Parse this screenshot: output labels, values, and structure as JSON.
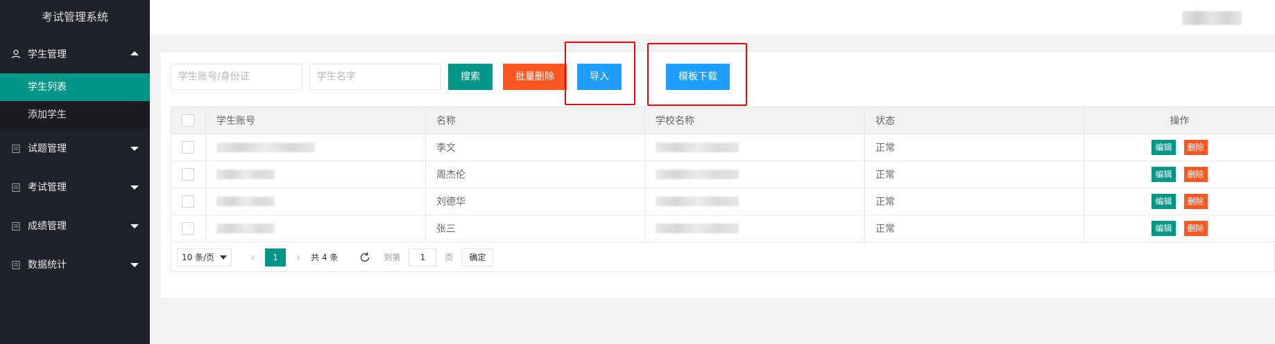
{
  "app": {
    "title": "考试管理系统"
  },
  "sidebar": {
    "groups": [
      {
        "label": "学生管理",
        "icon": "user-icon",
        "expanded": true,
        "items": [
          {
            "label": "学生列表",
            "active": true
          },
          {
            "label": "添加学生",
            "active": false
          }
        ]
      },
      {
        "label": "试题管理",
        "icon": "clipboard-icon",
        "expanded": false
      },
      {
        "label": "考试管理",
        "icon": "clipboard-icon",
        "expanded": false
      },
      {
        "label": "成绩管理",
        "icon": "clipboard-icon",
        "expanded": false
      },
      {
        "label": "数据统计",
        "icon": "clipboard-icon",
        "expanded": false
      }
    ]
  },
  "toolbar": {
    "account_placeholder": "学生账号/身份证",
    "name_placeholder": "学生名字",
    "search_label": "搜索",
    "batch_delete_label": "批量删除",
    "import_label": "导入",
    "template_download_label": "模板下载"
  },
  "table": {
    "columns": [
      "学生账号",
      "名称",
      "学校名称",
      "状态",
      "操作"
    ],
    "rows": [
      {
        "name": "李文",
        "status": "正常"
      },
      {
        "name": "周杰伦",
        "status": "正常"
      },
      {
        "name": "刘德华",
        "status": "正常"
      },
      {
        "name": "张三",
        "status": "正常"
      }
    ],
    "edit_label": "编辑",
    "delete_label": "删除"
  },
  "pager": {
    "page_size": "10 条/页",
    "current_page": "1",
    "total": "共 4 条",
    "goto_prefix": "到第",
    "goto_value": "1",
    "goto_suffix": "页",
    "confirm_label": "确定"
  },
  "colors": {
    "primary": "#009688",
    "danger": "#ff5722",
    "info": "#1e9fff",
    "sidebar": "#20222a",
    "highlight": "#ee0000"
  }
}
